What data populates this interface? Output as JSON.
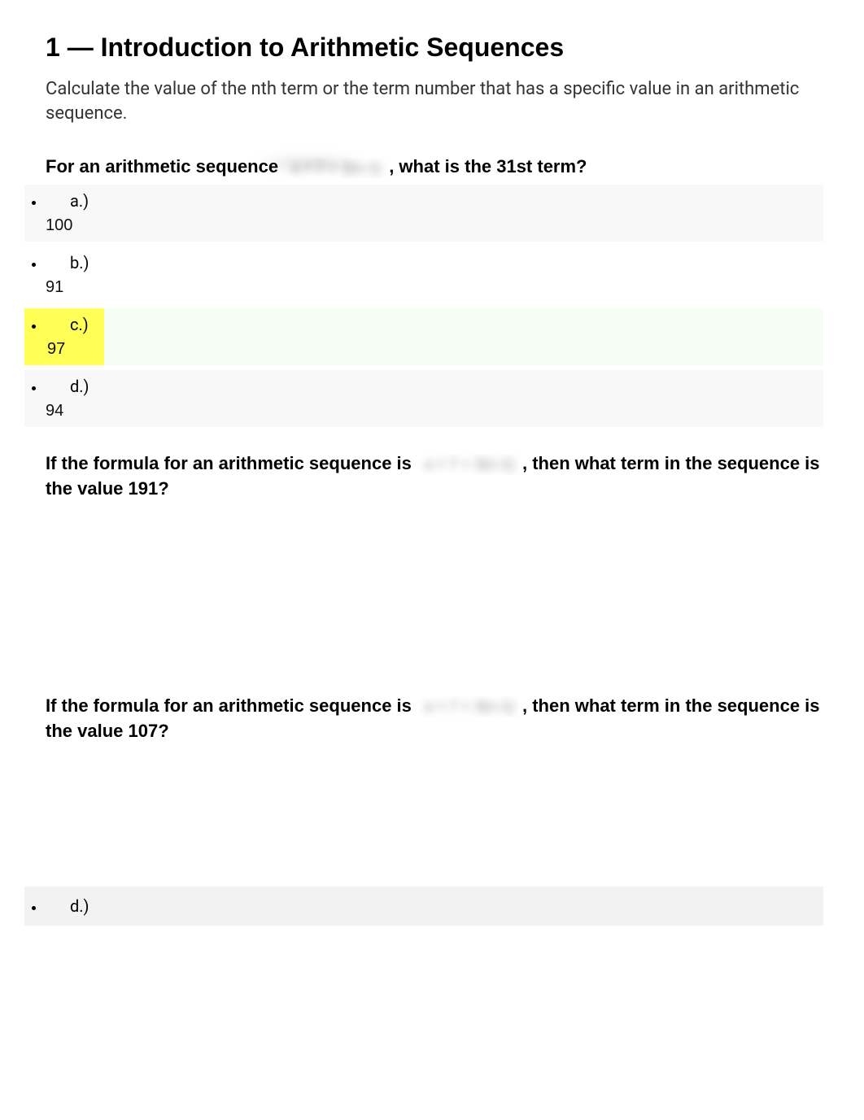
{
  "header": {
    "title": "1 — Introduction to Arithmetic Sequences",
    "description": "Calculate the value of the nth term or the term number that has a specific value in an arithmetic sequence."
  },
  "questions": [
    {
      "prompt_before": "For an arithmetic sequence ",
      "prompt_after": ", what is the 31st term?",
      "options": [
        {
          "label": "a.)",
          "value": "100",
          "highlight": false
        },
        {
          "label": "b.)",
          "value": "91",
          "highlight": false
        },
        {
          "label": "c.)",
          "value": "97",
          "highlight": true
        },
        {
          "label": "d.)",
          "value": "94",
          "highlight": false
        }
      ]
    },
    {
      "prompt_before": "If the formula for an arithmetic sequence is ",
      "prompt_after": ", then what term in the sequence is the value 191?"
    },
    {
      "prompt_before": "If the formula for an arithmetic sequence is ",
      "prompt_after": ", then what term in the sequence is the value 107?",
      "loose_option": {
        "label": "d.)"
      }
    }
  ]
}
